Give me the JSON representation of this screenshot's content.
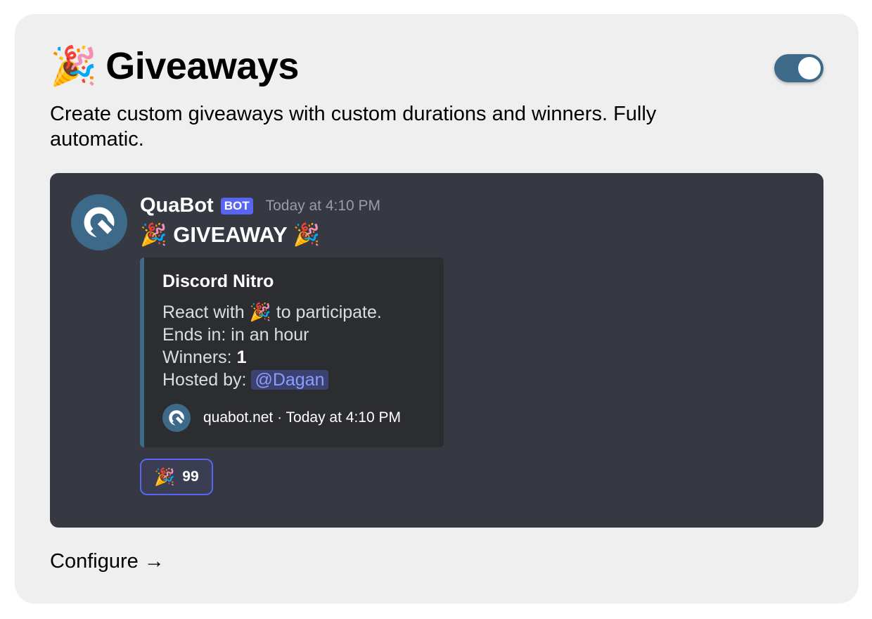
{
  "card": {
    "title_emoji": "🎉",
    "title": "Giveaways",
    "toggle_on": true,
    "description": "Create custom giveaways with custom durations and winners. Fully automatic.",
    "configure_label": "Configure",
    "configure_arrow": "→"
  },
  "message": {
    "author": "QuaBot",
    "badge": "BOT",
    "timestamp": "Today at 4:10 PM",
    "content": "🎉 GIVEAWAY 🎉",
    "embed": {
      "title": "Discord Nitro",
      "react_prefix": "React with",
      "react_emoji": "🎉",
      "react_suffix": "to participate.",
      "ends_label": "Ends in:",
      "ends_value": "in an hour",
      "winners_label": "Winners:",
      "winners_value": "1",
      "hosted_label": "Hosted by:",
      "hosted_value": "@Dagan",
      "footer": "quabot.net · Today at 4:10 PM"
    },
    "reaction": {
      "emoji": "🎉",
      "count": "99"
    }
  },
  "colors": {
    "brand": "#3e6a8a",
    "blurple": "#5865f2",
    "preview_bg": "#363842",
    "embed_bg": "#2b2d31"
  },
  "icons": {
    "avatar": "quabot-q-logo-icon",
    "toggle": "toggle-switch",
    "arrow": "arrow-right-icon"
  }
}
